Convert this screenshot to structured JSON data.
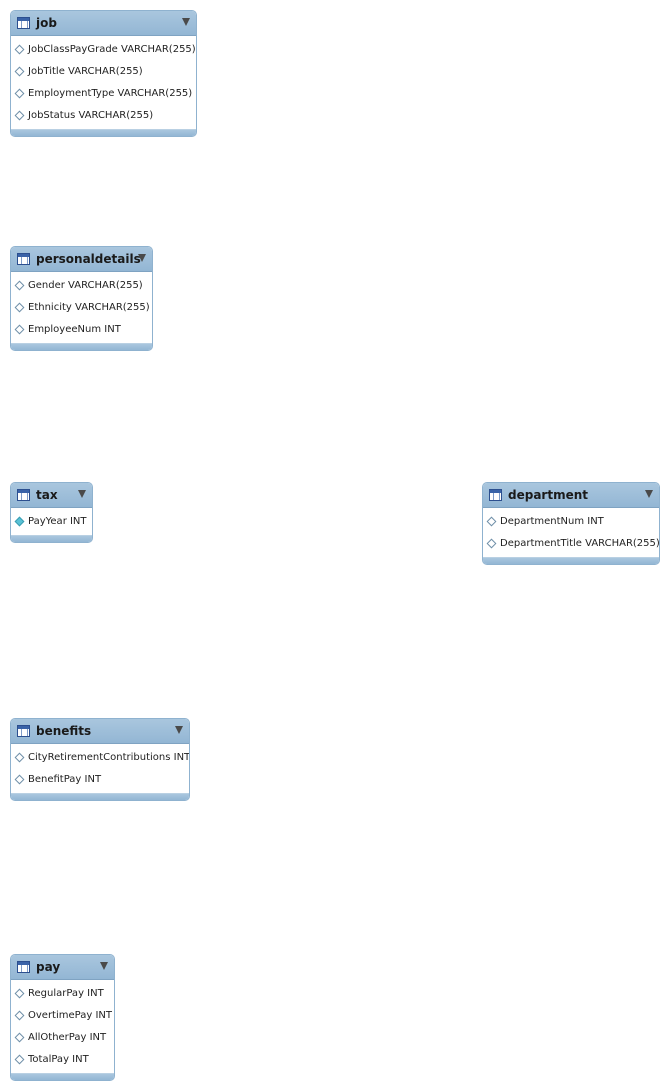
{
  "tables": {
    "job": {
      "name": "job",
      "columns": [
        {
          "label": "JobClassPayGrade VARCHAR(255)",
          "marker": "diamond-icon"
        },
        {
          "label": "JobTitle VARCHAR(255)",
          "marker": "diamond-icon"
        },
        {
          "label": "EmploymentType VARCHAR(255)",
          "marker": "diamond-icon"
        },
        {
          "label": "JobStatus VARCHAR(255)",
          "marker": "diamond-icon"
        }
      ]
    },
    "personaldetails": {
      "name": "personaldetails",
      "columns": [
        {
          "label": "Gender VARCHAR(255)",
          "marker": "diamond-icon"
        },
        {
          "label": "Ethnicity VARCHAR(255)",
          "marker": "diamond-icon"
        },
        {
          "label": "EmployeeNum INT",
          "marker": "diamond-icon"
        }
      ]
    },
    "tax": {
      "name": "tax",
      "columns": [
        {
          "label": "PayYear INT",
          "marker": "filled-diamond-icon"
        }
      ]
    },
    "department": {
      "name": "department",
      "columns": [
        {
          "label": "DepartmentNum INT",
          "marker": "diamond-icon"
        },
        {
          "label": "DepartmentTitle VARCHAR(255)",
          "marker": "diamond-icon"
        }
      ]
    },
    "benefits": {
      "name": "benefits",
      "columns": [
        {
          "label": "CityRetirementContributions INT",
          "marker": "diamond-icon"
        },
        {
          "label": "BenefitPay INT",
          "marker": "diamond-icon"
        }
      ]
    },
    "pay": {
      "name": "pay",
      "columns": [
        {
          "label": "RegularPay INT",
          "marker": "diamond-icon"
        },
        {
          "label": "OvertimePay INT",
          "marker": "diamond-icon"
        },
        {
          "label": "AllOtherPay INT",
          "marker": "diamond-icon"
        },
        {
          "label": "TotalPay INT",
          "marker": "diamond-icon"
        }
      ]
    }
  },
  "colors": {
    "header": "#9bbcd8",
    "border": "#8fb2cf",
    "key_marker": "#59c2d6"
  }
}
